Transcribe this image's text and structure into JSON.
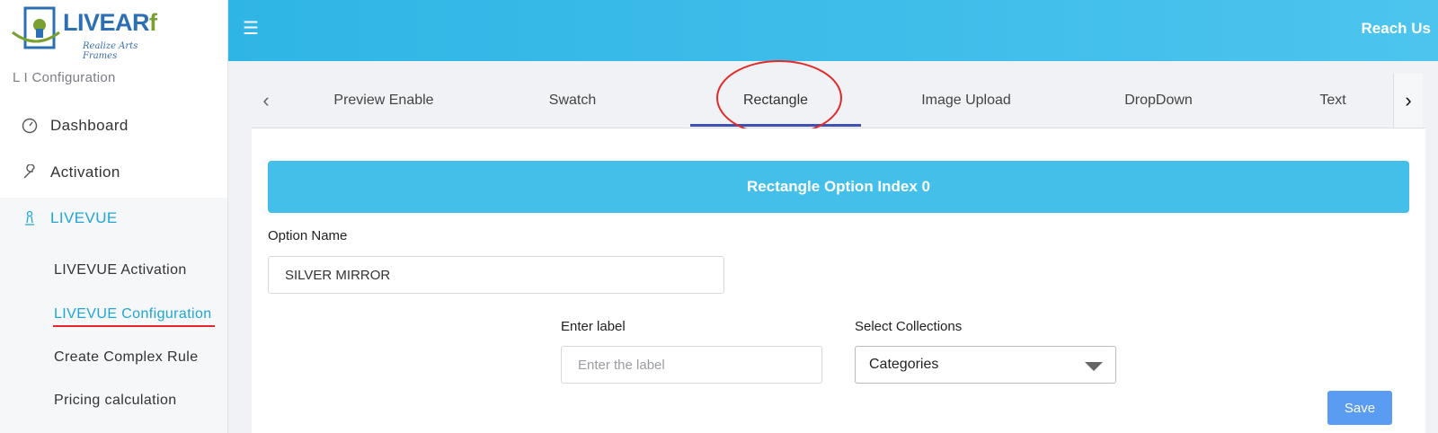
{
  "logo": {
    "text_main": "LIVEAR",
    "text_accent": "f",
    "tagline": "Realize Arts Frames"
  },
  "sidebar": {
    "caption": "L I Configuration",
    "items": [
      {
        "label": "Dashboard",
        "icon": "speedometer-icon"
      },
      {
        "label": "Activation",
        "icon": "wrench-icon"
      },
      {
        "label": "LIVEVUE",
        "icon": "chess-pawn-icon"
      }
    ],
    "submenu": [
      {
        "label": "LIVEVUE Activation"
      },
      {
        "label": "LIVEVUE Configuration"
      },
      {
        "label": "Create Complex Rule"
      },
      {
        "label": "Pricing calculation"
      }
    ]
  },
  "topbar": {
    "menu_icon": "hamburger-icon",
    "reach_label": "Reach Us"
  },
  "tabs": {
    "items": [
      "Preview Enable",
      "Swatch",
      "Rectangle",
      "Image Upload",
      "DropDown",
      "Text"
    ],
    "active": "Rectangle"
  },
  "form": {
    "banner_title": "Rectangle Option Index 0",
    "option_name_label": "Option Name",
    "option_name_value": "SILVER MIRROR",
    "enter_label_label": "Enter label",
    "enter_label_placeholder": "Enter the label",
    "collections_label": "Select Collections",
    "collections_value": "Categories",
    "save_label": "Save"
  },
  "colors": {
    "accent": "#43bfe9",
    "tab_indicator": "#3f51b5",
    "highlight_red": "#e32a2a",
    "save_button": "#5a9cf2"
  }
}
